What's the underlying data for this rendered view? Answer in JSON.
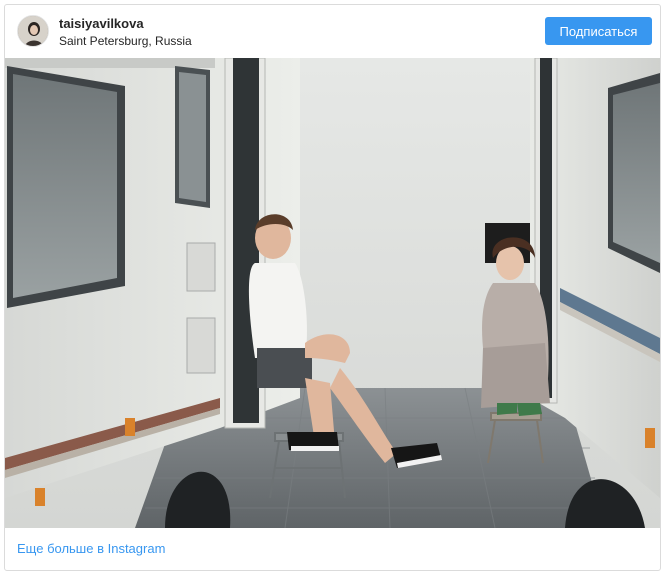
{
  "post": {
    "username": "taisiyavilkova",
    "location": "Saint Petersburg, Russia",
    "follow_label": "Подписаться",
    "image_icon": "photo-image",
    "more_link": "Еще больше в Instagram"
  },
  "colors": {
    "accent": "#3897f0",
    "text": "#262626",
    "border": "#dbdbdb"
  }
}
